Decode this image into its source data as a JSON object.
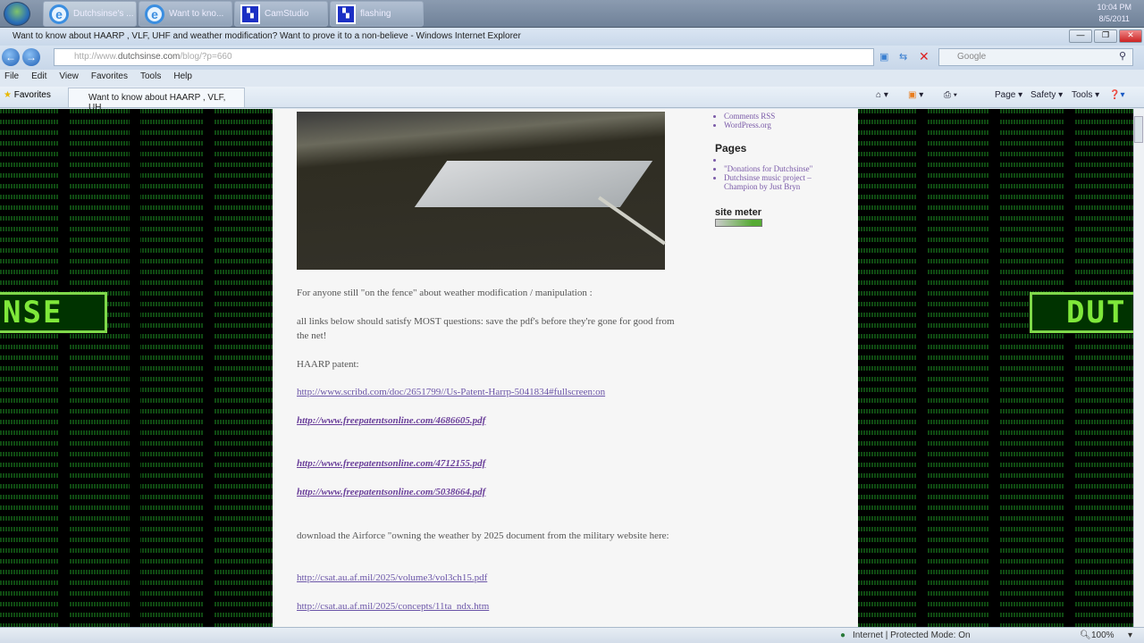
{
  "taskbar": {
    "items": [
      {
        "label": "Dutchsinse's ...",
        "icon": "ie-icon"
      },
      {
        "label": "Want to kno...",
        "icon": "ie-icon"
      },
      {
        "label": "CamStudio",
        "icon": "camstudio-icon"
      },
      {
        "label": "flashing",
        "icon": "camstudio-icon"
      }
    ],
    "time": "10:04 PM",
    "date": "8/5/2011"
  },
  "window": {
    "title": "Want to know about HAARP , VLF, UHF and weather modification? Want to prove it to a non-believe - Windows Internet Explorer"
  },
  "address": {
    "url_prefix": "http://www.",
    "url_domain": "dutchsinse.com",
    "url_path": "/blog/?p=660",
    "search_placeholder": "Google"
  },
  "menu": [
    "File",
    "Edit",
    "View",
    "Favorites",
    "Tools",
    "Help"
  ],
  "favorites": {
    "label": "Favorites",
    "tab": "Want to know about HAARP , VLF, UH..."
  },
  "commandbar": {
    "page": "Page ▾",
    "safety": "Safety ▾",
    "tools": "Tools ▾"
  },
  "banners": {
    "left": "NSE",
    "right": "DUT"
  },
  "article": {
    "p1": "For anyone still \"on the fence\" about weather modification / manipulation :",
    "p2": "all links below should satisfy MOST questions:  save the pdf's before they're gone for good from the net!",
    "p3": "HAARP patent:",
    "links": [
      "http://www.scribd.com/doc/2651799//Us-Patent-Harrp-5041834#fullscreen:on",
      "http://www.freepatentsonline.com/4686605.pdf",
      "http://www.freepatentsonline.com/4712155.pdf",
      "http://www.freepatentsonline.com/5038664.pdf"
    ],
    "p4": "download the Airforce \"owning the weather by 2025 document from the military website here:",
    "links2": [
      "http://csat.au.af.mil/2025/volume3/vol3ch15.pdf",
      "http://csat.au.af.mil/2025/concepts/11ta_ndx.htm"
    ]
  },
  "sidebar": {
    "meta": [
      "Comments RSS",
      "WordPress.org"
    ],
    "pages_title": "Pages",
    "pages": [
      "",
      "\"Donations for Dutchsinse\"",
      "Dutchsinse music project – Champion by Just Bryn"
    ],
    "sitemeter": "site meter"
  },
  "status": {
    "zone": "Internet | Protected Mode: On",
    "zoom": "100%"
  }
}
